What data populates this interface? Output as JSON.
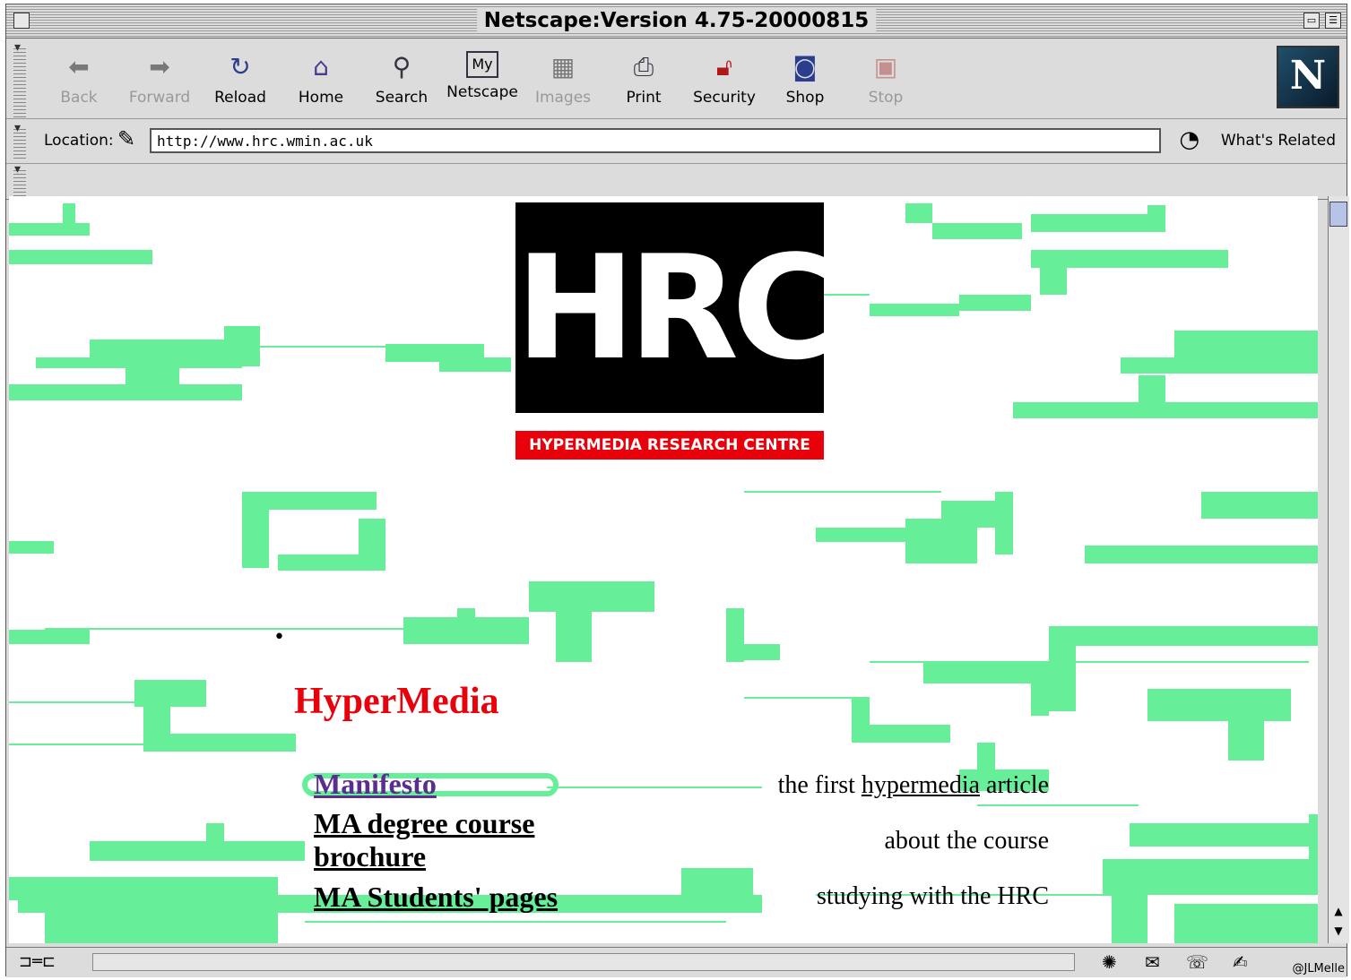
{
  "window": {
    "title": "Netscape:Version 4.75-20000815"
  },
  "toolbar": {
    "buttons": [
      {
        "label": "Back",
        "icon": "back-arrow-icon",
        "enabled": false
      },
      {
        "label": "Forward",
        "icon": "forward-arrow-icon",
        "enabled": false
      },
      {
        "label": "Reload",
        "icon": "reload-icon",
        "enabled": true
      },
      {
        "label": "Home",
        "icon": "home-icon",
        "enabled": true
      },
      {
        "label": "Search",
        "icon": "search-icon",
        "enabled": true
      },
      {
        "label": "Netscape",
        "icon": "my-netscape-icon",
        "enabled": true
      },
      {
        "label": "Images",
        "icon": "images-icon",
        "enabled": false
      },
      {
        "label": "Print",
        "icon": "print-icon",
        "enabled": true
      },
      {
        "label": "Security",
        "icon": "security-lock-icon",
        "enabled": true
      },
      {
        "label": "Shop",
        "icon": "shop-icon",
        "enabled": true
      },
      {
        "label": "Stop",
        "icon": "stop-icon",
        "enabled": false
      }
    ],
    "logo": "N"
  },
  "location": {
    "label": "Location:",
    "url": "http://www.hrc.wmin.ac.uk",
    "related_label": "What's Related"
  },
  "page": {
    "logo_text": "HRC",
    "banner": "HYPERMEDIA RESEARCH CENTRE",
    "heading": "HyperMedia",
    "links": [
      {
        "label": "Manifesto",
        "visited": true
      },
      {
        "label": "MA degree course",
        "label2": "brochure",
        "visited": false
      },
      {
        "label": "MA Students' pages",
        "visited": false
      }
    ],
    "descriptions": {
      "d1_before": "the first ",
      "d1_link": "hypermedia",
      "d1_after": " article",
      "d2": "about the course",
      "d3": "studying with the HRC"
    }
  },
  "status": {
    "credit": "@JLMelle"
  },
  "colors": {
    "accent_red": "#e8000b",
    "pattern_green": "#66ee99",
    "visited_link": "#5b2d91"
  }
}
